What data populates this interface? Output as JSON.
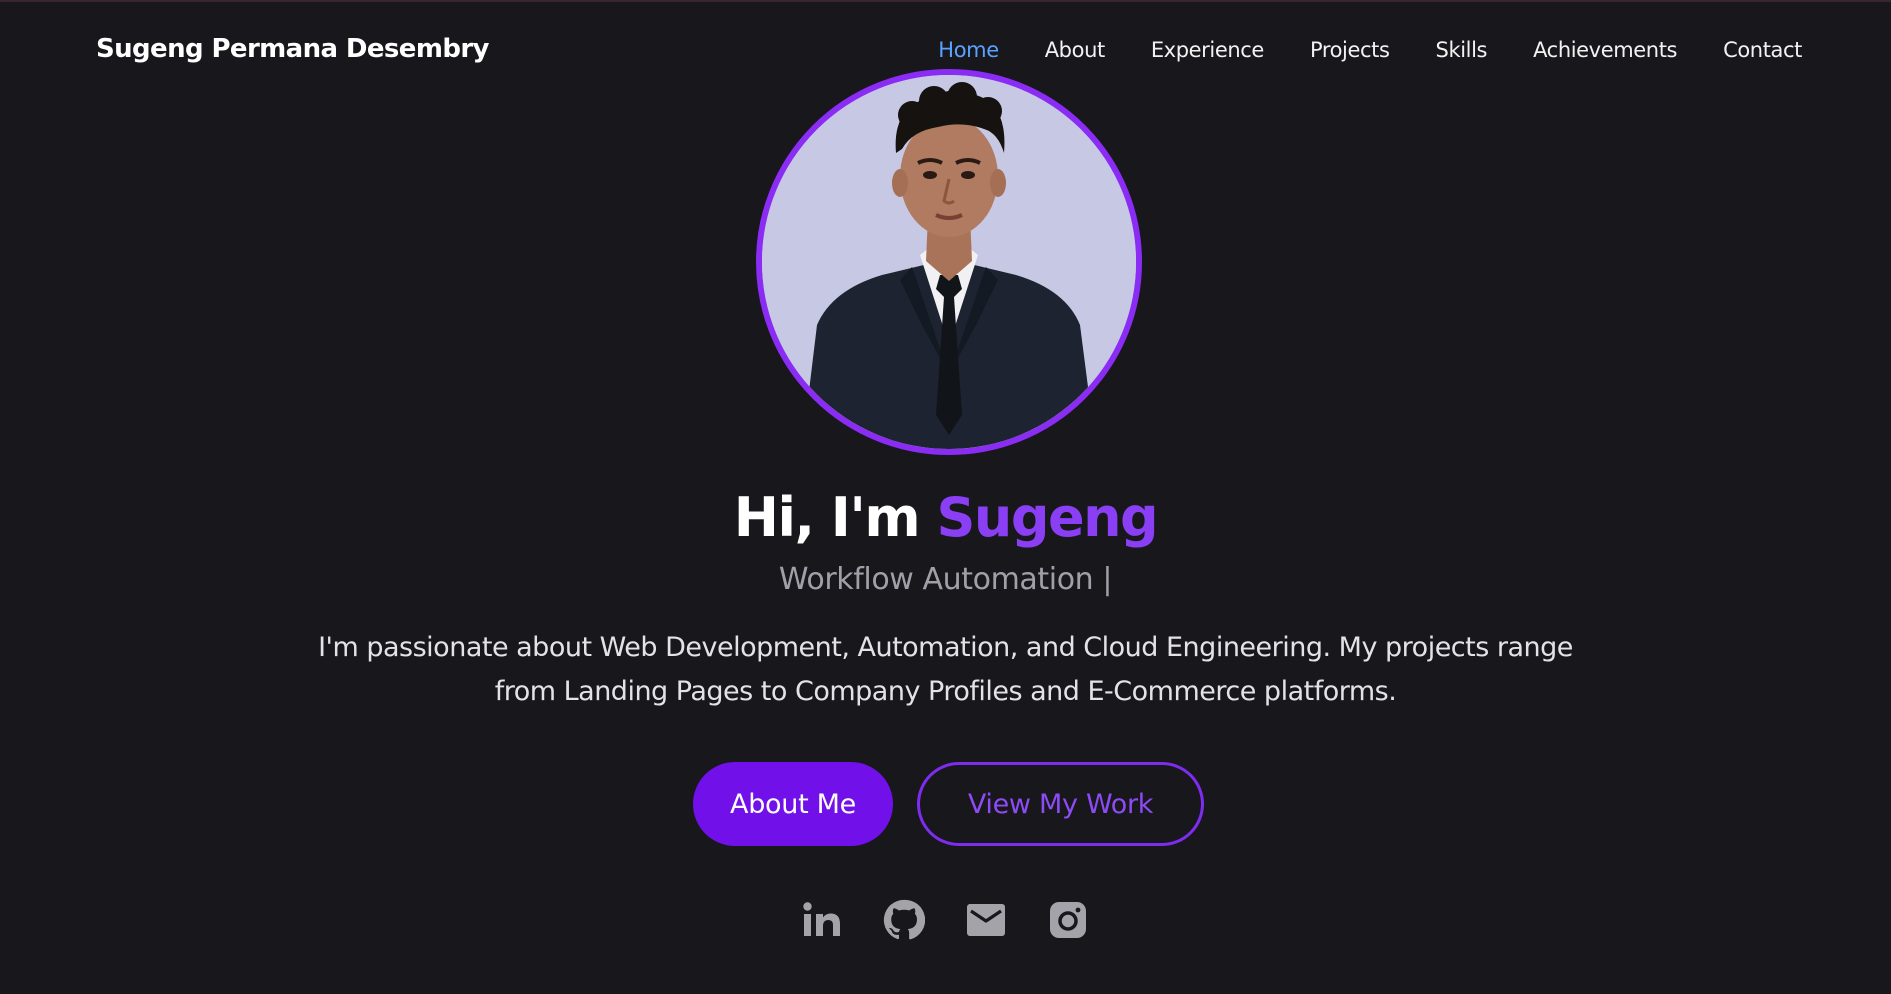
{
  "header": {
    "brand": "Sugeng Permana Desembry",
    "nav": [
      {
        "label": "Home",
        "active": true
      },
      {
        "label": "About",
        "active": false
      },
      {
        "label": "Experience",
        "active": false
      },
      {
        "label": "Projects",
        "active": false
      },
      {
        "label": "Skills",
        "active": false
      },
      {
        "label": "Achievements",
        "active": false
      },
      {
        "label": "Contact",
        "active": false
      }
    ]
  },
  "hero": {
    "greeting": "Hi, I'm ",
    "name": "Sugeng",
    "role": "Workflow Automation |",
    "bio": "I'm passionate about Web Development, Automation, and Cloud Engineering. My projects range from Landing Pages to Company Profiles and E-Commerce platforms.",
    "primary_button": "About Me",
    "secondary_button": "View My Work",
    "socials": [
      {
        "icon": "linkedin-icon"
      },
      {
        "icon": "github-icon"
      },
      {
        "icon": "email-icon"
      },
      {
        "icon": "instagram-icon"
      }
    ]
  },
  "colors": {
    "background": "#18171c",
    "accent": "#7110e8",
    "accent_light": "#8b3ff5",
    "nav_active": "#5aa2ff",
    "muted": "#a19fa8"
  }
}
